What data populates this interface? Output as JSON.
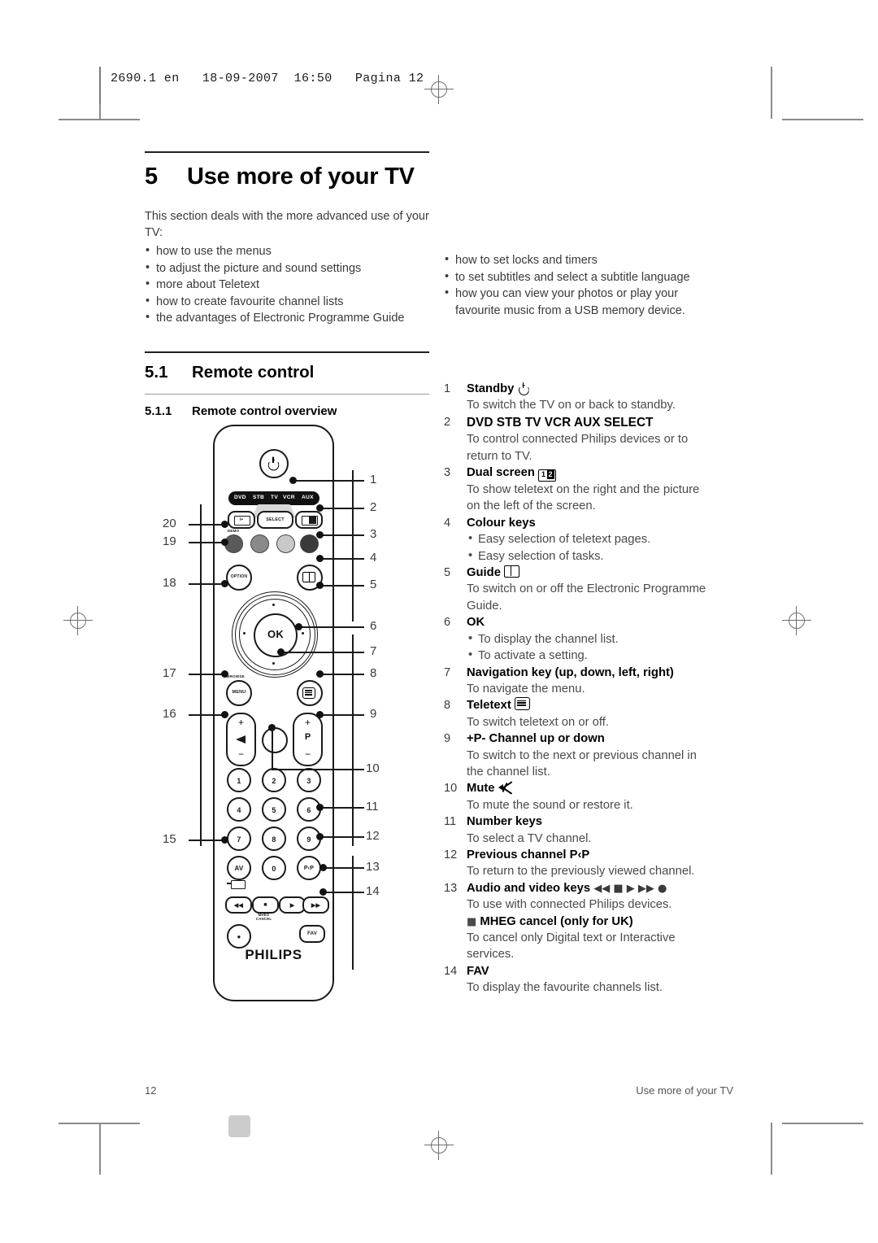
{
  "slug": "2690.1 en   18-09-2007  16:50   Pagina 12",
  "chapter": {
    "number": "5",
    "title": "Use more of your TV"
  },
  "intro": {
    "lead": "This section deals with the more advanced use of your TV:",
    "left_bullets": [
      "how to use the menus",
      "to adjust the picture and sound settings",
      "more about Teletext",
      "how to create favourite channel lists",
      "the advantages of Electronic Programme Guide"
    ],
    "right_bullets": [
      "how to set locks and timers",
      "to set subtitles and select a subtitle language",
      "how you can view your photos or play your"
    ],
    "right_bullet_cont": "favourite music from a USB memory device."
  },
  "section": {
    "number": "5.1",
    "title": "Remote control"
  },
  "subsection": {
    "number": "5.1.1",
    "title": "Remote control overview"
  },
  "legend": [
    {
      "n": "1",
      "title": "Standby",
      "icon": "power-icon",
      "desc": [
        "To switch the TV on or back to standby."
      ]
    },
    {
      "n": "2",
      "title": "DVD  STB  TV  VCR  AUX   SELECT",
      "desc": [
        "To control connected Philips devices or to",
        "return to TV."
      ]
    },
    {
      "n": "3",
      "title": "Dual screen",
      "icon": "dual-screen-icon",
      "desc": [
        "To show teletext on the right and the picture",
        "on the left of the screen."
      ]
    },
    {
      "n": "4",
      "title": "Colour keys",
      "bullets": [
        "Easy selection of teletext pages.",
        "Easy selection of tasks."
      ]
    },
    {
      "n": "5",
      "title": "Guide",
      "icon": "guide-book-icon",
      "desc": [
        "To switch on or off the Electronic Programme",
        "Guide."
      ]
    },
    {
      "n": "6",
      "title": "OK",
      "bullets": [
        "To display the channel list.",
        "To activate a setting."
      ]
    },
    {
      "n": "7",
      "title": "Navigation key  (up, down, left, right)",
      "desc": [
        "To navigate the menu."
      ]
    },
    {
      "n": "8",
      "title": "Teletext",
      "icon": "teletext-icon",
      "desc": [
        "To switch teletext on or off."
      ]
    },
    {
      "n": "9",
      "title": "+P-  Channel up or down",
      "desc": [
        "To switch to the next or previous channel in",
        "the channel list."
      ]
    },
    {
      "n": "10",
      "title": "Mute",
      "icon": "mute-icon",
      "desc": [
        "To mute the sound or restore it."
      ]
    },
    {
      "n": "11",
      "title": "Number keys",
      "desc": [
        "To select a TV channel."
      ]
    },
    {
      "n": "12",
      "title": "Previous channel P‹P",
      "desc": [
        "To return to the previously viewed channel."
      ]
    },
    {
      "n": "13",
      "title": "Audio and video keys",
      "icon": "av-transport-icons",
      "desc": [
        "To use with connected Philips devices."
      ],
      "sub_title": "MHEG cancel (only for UK)",
      "sub_icon": "stop-square-icon",
      "sub_desc": [
        "To cancel only Digital text or Interactive",
        "services."
      ]
    },
    {
      "n": "14",
      "title": "FAV",
      "desc": [
        "To display the favourite channels list."
      ]
    }
  ],
  "remote": {
    "brand": "PHILIPS",
    "source_bar": [
      "DVD",
      "STB",
      "TV",
      "VCR",
      "AUX"
    ],
    "select_label": "SELECT",
    "info_label": "i+",
    "dual_label_a": "1",
    "dual_label_b": "2",
    "demo_label": "DEMO",
    "option_label": "OPTION",
    "browse_label": "BROWSE",
    "menu_label": "MENU",
    "ok_label": "OK",
    "program_label": "P",
    "plus": "+",
    "minus": "−",
    "number_keys": [
      "1",
      "2",
      "3",
      "4",
      "5",
      "6",
      "7",
      "8",
      "9",
      "AV",
      "0",
      "P‹P"
    ],
    "mheg_label": "MHEG\nCANCEL",
    "fav_label": "FAV",
    "colour_keys": [
      "#5a5a5a",
      "#8a8a8a",
      "#c9c9c9",
      "#3a3a3a"
    ],
    "callouts_right": [
      "1",
      "2",
      "3",
      "4",
      "5",
      "6",
      "7",
      "8",
      "9",
      "10",
      "11",
      "12",
      "13",
      "14"
    ],
    "callouts_left": [
      "20",
      "19",
      "18",
      "17",
      "16",
      "15"
    ]
  },
  "footer": {
    "page": "12",
    "title": "Use more of your TV"
  }
}
